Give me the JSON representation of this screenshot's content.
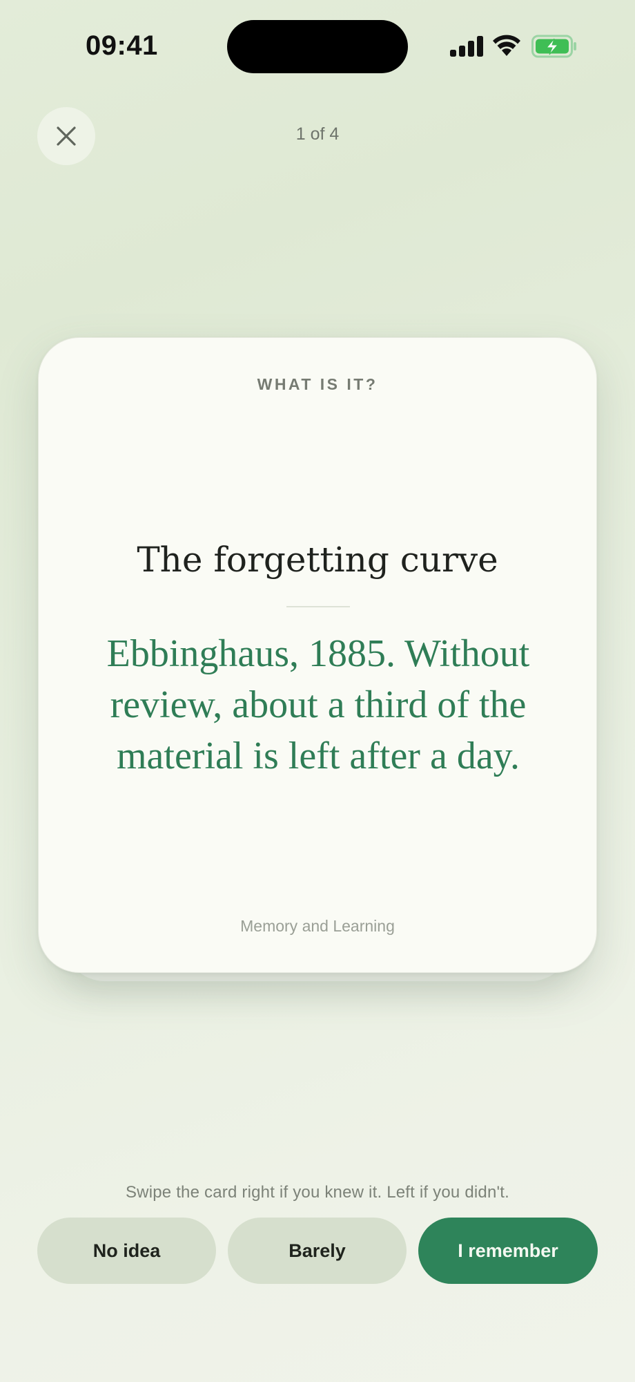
{
  "status_bar": {
    "time": "09:41",
    "icons": [
      "cellular-signal-icon",
      "wifi-icon",
      "battery-charging-icon"
    ],
    "battery_color": "#3fbe55"
  },
  "top_bar": {
    "close_icon": "close-icon",
    "progress_text": "1 of 4"
  },
  "card": {
    "kicker": "WHAT IS IT?",
    "title": "The forgetting curve",
    "answer": "Ebbinghaus, 1885. Without review, about a third of the material is left after a day.",
    "deck": "Memory and Learning"
  },
  "hint": "Swipe the card right if you knew it. Left if you didn't.",
  "actions": {
    "no_idea": "No idea",
    "barely": "Barely",
    "remember": "I remember"
  },
  "colors": {
    "accent": "#2e845a",
    "answer_text": "#2f7d56",
    "secondary_button": "#d6dfcd"
  }
}
